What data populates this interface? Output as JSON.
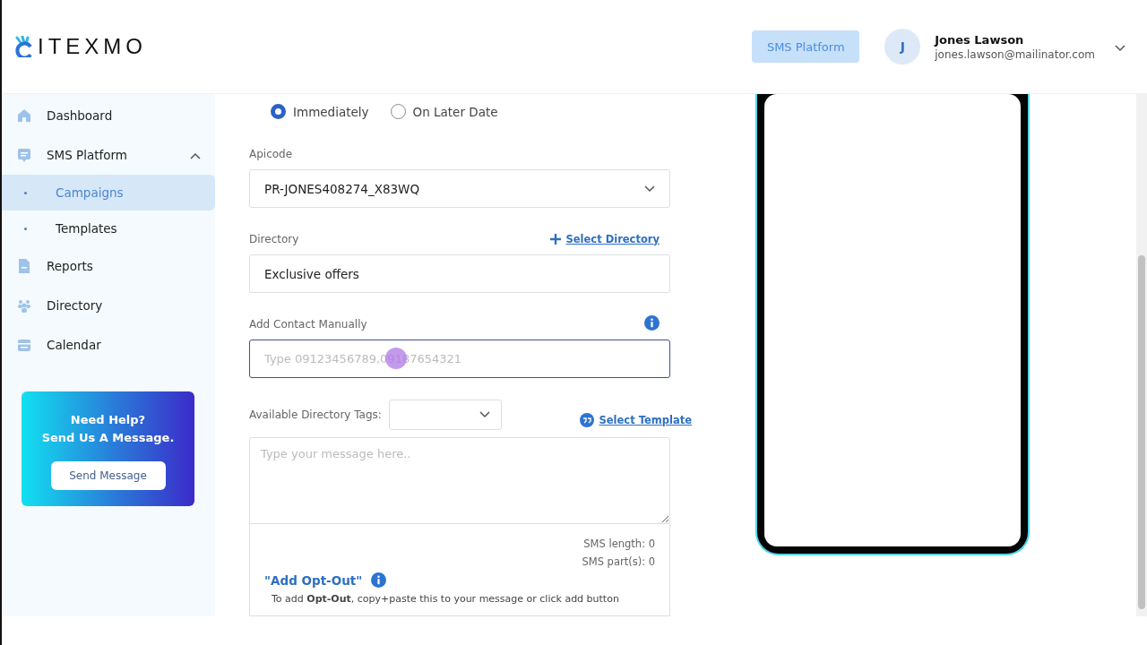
{
  "header": {
    "logo": "ITEXMO",
    "platform_button": "SMS Platform",
    "user": {
      "initial": "J",
      "name": "Jones Lawson",
      "email": "jones.lawson@mailinator.com"
    }
  },
  "sidebar": {
    "items": [
      {
        "label": "Dashboard",
        "selected": false
      },
      {
        "label": "SMS Platform",
        "selected": false,
        "expanded": true,
        "children": [
          {
            "label": "Campaigns",
            "selected": true
          },
          {
            "label": "Templates",
            "selected": false
          }
        ]
      },
      {
        "label": "Reports",
        "selected": false
      },
      {
        "label": "Directory",
        "selected": false
      },
      {
        "label": "Calendar",
        "selected": false
      }
    ],
    "help": {
      "title": "Need Help?",
      "subtitle": "Send Us A Message.",
      "button": "Send Message"
    }
  },
  "form": {
    "schedule": [
      {
        "label": "Immediately",
        "selected": true
      },
      {
        "label": "On Later Date",
        "selected": false
      }
    ],
    "apicode": {
      "label": "Apicode",
      "value": "PR-JONES408274_X83WQ"
    },
    "directory": {
      "label": "Directory",
      "link": "Select Directory",
      "value": "Exclusive offers"
    },
    "contact": {
      "label": "Add Contact Manually",
      "placeholder": "Type 09123456789,09187654321"
    },
    "tags": {
      "label": "Available Directory Tags:",
      "link": "Select Template"
    },
    "message": {
      "placeholder": "Type your message here..",
      "sms_length": "SMS length: 0",
      "sms_parts": "SMS part(s): 0",
      "opt_out_title": "\"Add Opt-Out\"",
      "opt_out_text": "To add **Opt-Out**, copy+paste this to your message or click add button"
    }
  }
}
